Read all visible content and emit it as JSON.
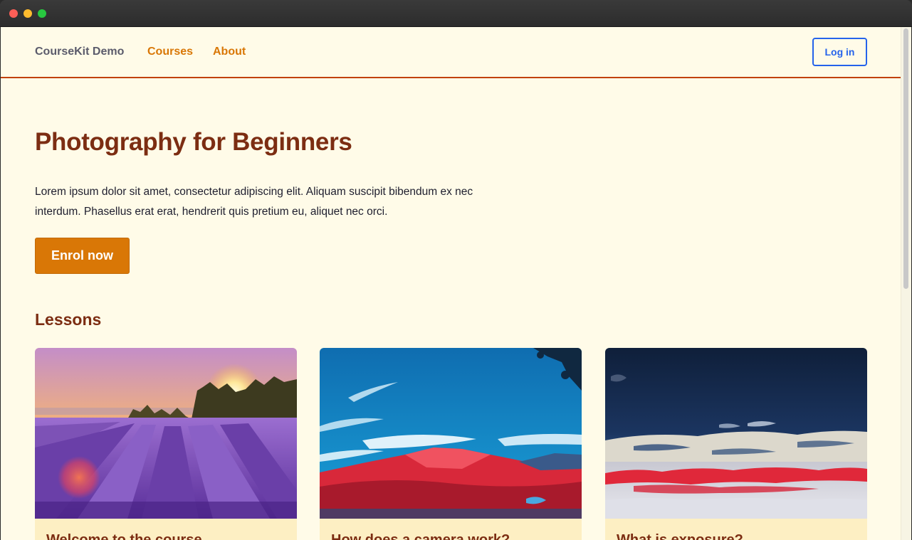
{
  "window": {
    "controls": [
      "close",
      "minimize",
      "maximize"
    ]
  },
  "nav": {
    "brand": "CourseKit Demo",
    "links": [
      "Courses",
      "About"
    ],
    "login_label": "Log in"
  },
  "hero": {
    "title": "Photography for Beginners",
    "description": "Lorem ipsum dolor sit amet, consectetur adipiscing elit. Aliquam suscipit bibendum ex nec interdum. Phasellus erat erat, hendrerit quis pretium eu, aliquet nec orci.",
    "cta_label": "Enrol now"
  },
  "lessons": {
    "heading": "Lessons",
    "cards": [
      {
        "title": "Welcome to the course",
        "image": "lavender-field-sunset-photo"
      },
      {
        "title": "How does a camera work?",
        "image": "red-mountain-blue-sky-photo"
      },
      {
        "title": "What is exposure?",
        "image": "red-grass-dark-sky-photo"
      }
    ]
  },
  "colors": {
    "page_bg": "#fffbe8",
    "accent": "#d97706",
    "heading": "#7c2d12",
    "nav_border": "#c2410c",
    "login_blue": "#2563eb",
    "card_bg": "#fdefc3"
  }
}
